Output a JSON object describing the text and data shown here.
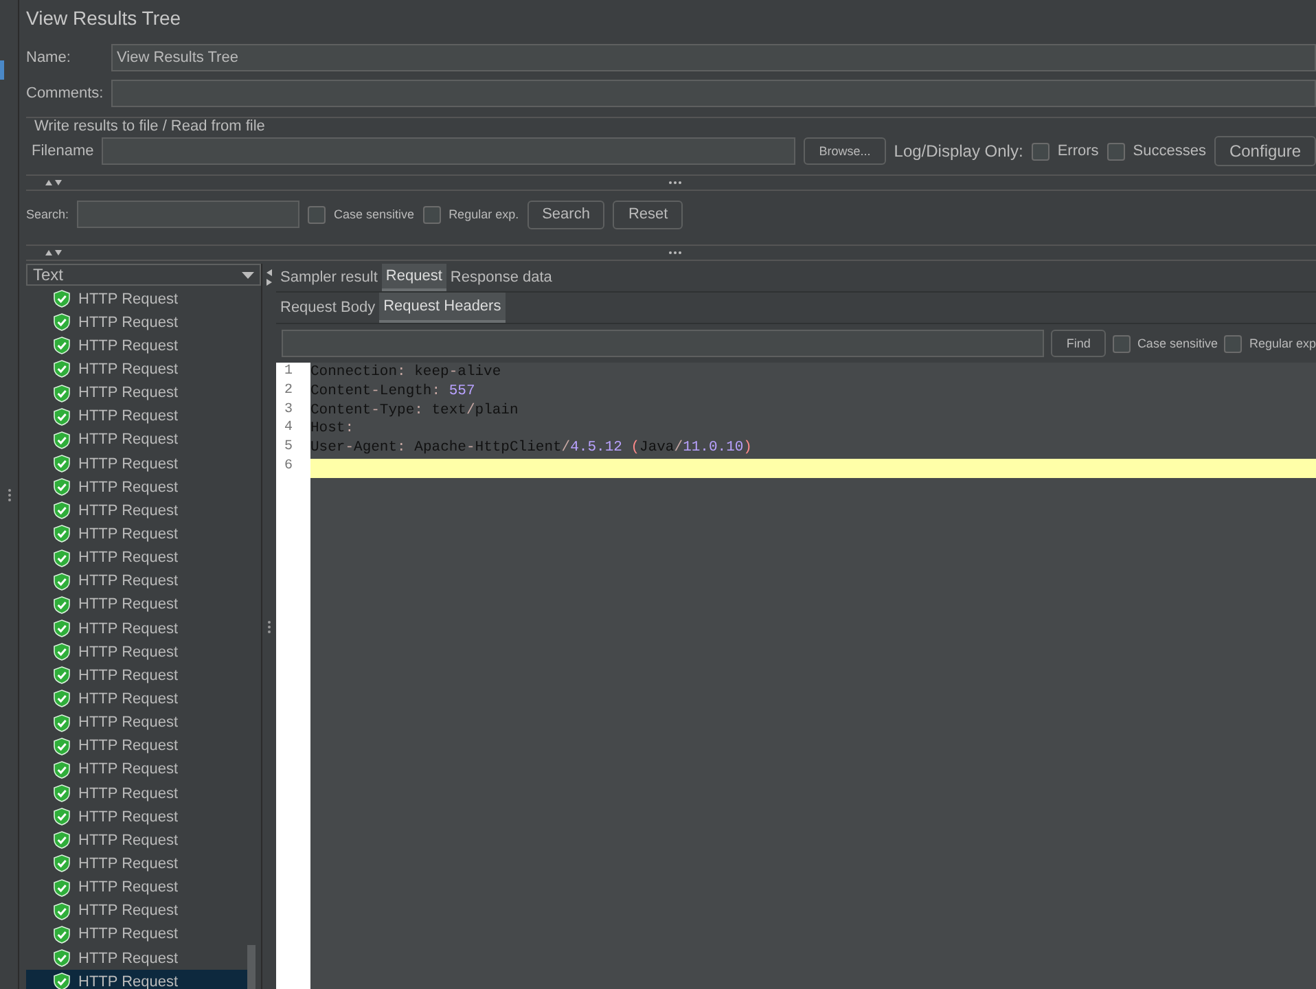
{
  "window": {
    "title": "View Results Tree"
  },
  "name_field": {
    "label": "Name:",
    "value": "View Results Tree"
  },
  "comments_field": {
    "label": "Comments:"
  },
  "file_group": {
    "legend": "Write results to file / Read from file",
    "filename_label": "Filename",
    "browse": "Browse...",
    "log_label": "Log/Display Only:",
    "errors": {
      "label": "Errors",
      "checked": false
    },
    "successes": {
      "label": "Successes",
      "checked": false
    },
    "configure": "Configure"
  },
  "search": {
    "label": "Search:",
    "case_sensitive": {
      "label": "Case sensitive",
      "checked": false
    },
    "regex": {
      "label": "Regular exp.",
      "checked": false
    },
    "search_button": "Search",
    "reset_button": "Reset"
  },
  "renderer": {
    "value": "Text"
  },
  "tree": [
    {
      "label": "HTTP Request",
      "selected": false
    },
    {
      "label": "HTTP Request",
      "selected": false
    },
    {
      "label": "HTTP Request",
      "selected": false
    },
    {
      "label": "HTTP Request",
      "selected": false
    },
    {
      "label": "HTTP Request",
      "selected": false
    },
    {
      "label": "HTTP Request",
      "selected": false
    },
    {
      "label": "HTTP Request",
      "selected": false
    },
    {
      "label": "HTTP Request",
      "selected": false
    },
    {
      "label": "HTTP Request",
      "selected": false
    },
    {
      "label": "HTTP Request",
      "selected": false
    },
    {
      "label": "HTTP Request",
      "selected": false
    },
    {
      "label": "HTTP Request",
      "selected": false
    },
    {
      "label": "HTTP Request",
      "selected": false
    },
    {
      "label": "HTTP Request",
      "selected": false
    },
    {
      "label": "HTTP Request",
      "selected": false
    },
    {
      "label": "HTTP Request",
      "selected": false
    },
    {
      "label": "HTTP Request",
      "selected": false
    },
    {
      "label": "HTTP Request",
      "selected": false
    },
    {
      "label": "HTTP Request",
      "selected": false
    },
    {
      "label": "HTTP Request",
      "selected": false
    },
    {
      "label": "HTTP Request",
      "selected": false
    },
    {
      "label": "HTTP Request",
      "selected": false
    },
    {
      "label": "HTTP Request",
      "selected": false
    },
    {
      "label": "HTTP Request",
      "selected": false
    },
    {
      "label": "HTTP Request",
      "selected": false
    },
    {
      "label": "HTTP Request",
      "selected": false
    },
    {
      "label": "HTTP Request",
      "selected": false
    },
    {
      "label": "HTTP Request",
      "selected": false
    },
    {
      "label": "HTTP Request",
      "selected": false
    },
    {
      "label": "HTTP Request",
      "selected": true
    }
  ],
  "tabs": [
    {
      "label": "Sampler result",
      "selected": false
    },
    {
      "label": "Request",
      "selected": true
    },
    {
      "label": "Response data",
      "selected": false
    }
  ],
  "subtabs": [
    {
      "label": "Request Body",
      "selected": false
    },
    {
      "label": "Request Headers",
      "selected": true
    }
  ],
  "find": {
    "button": "Find",
    "case_sensitive": {
      "label": "Case sensitive",
      "checked": false
    },
    "regex": {
      "label": "Regular exp",
      "checked": false
    }
  },
  "editor": {
    "lines": [
      {
        "number": "1",
        "tokens": [
          {
            "text": "Connection",
            "kind": "plain"
          },
          {
            "text": ":",
            "kind": "punct"
          },
          {
            "text": " keep",
            "kind": "plain"
          },
          {
            "text": "-",
            "kind": "punct"
          },
          {
            "text": "alive",
            "kind": "plain"
          }
        ]
      },
      {
        "number": "2",
        "tokens": [
          {
            "text": "Content",
            "kind": "plain"
          },
          {
            "text": "-",
            "kind": "punct"
          },
          {
            "text": "Length",
            "kind": "plain"
          },
          {
            "text": ":",
            "kind": "punct"
          },
          {
            "text": " 557",
            "kind": "number"
          }
        ]
      },
      {
        "number": "3",
        "tokens": [
          {
            "text": "Content",
            "kind": "plain"
          },
          {
            "text": "-",
            "kind": "punct"
          },
          {
            "text": "Type",
            "kind": "plain"
          },
          {
            "text": ":",
            "kind": "punct"
          },
          {
            "text": " text",
            "kind": "plain"
          },
          {
            "text": "/",
            "kind": "punct"
          },
          {
            "text": "plain",
            "kind": "plain"
          }
        ]
      },
      {
        "number": "4",
        "tokens": [
          {
            "text": "Host",
            "kind": "plain"
          },
          {
            "text": ":",
            "kind": "punct"
          }
        ]
      },
      {
        "number": "5",
        "tokens": [
          {
            "text": "User",
            "kind": "plain"
          },
          {
            "text": "-",
            "kind": "punct"
          },
          {
            "text": "Agent",
            "kind": "plain"
          },
          {
            "text": ":",
            "kind": "punct"
          },
          {
            "text": " Apache",
            "kind": "plain"
          },
          {
            "text": "-",
            "kind": "punct"
          },
          {
            "text": "HttpClient",
            "kind": "plain"
          },
          {
            "text": "/",
            "kind": "punct"
          },
          {
            "text": "4.5.12",
            "kind": "number"
          },
          {
            "text": " (",
            "kind": "paren"
          },
          {
            "text": "Java",
            "kind": "plain"
          },
          {
            "text": "/",
            "kind": "punct"
          },
          {
            "text": "11.0.10",
            "kind": "number"
          },
          {
            "text": ")",
            "kind": "paren"
          }
        ]
      },
      {
        "number": "6",
        "current": true
      }
    ]
  }
}
